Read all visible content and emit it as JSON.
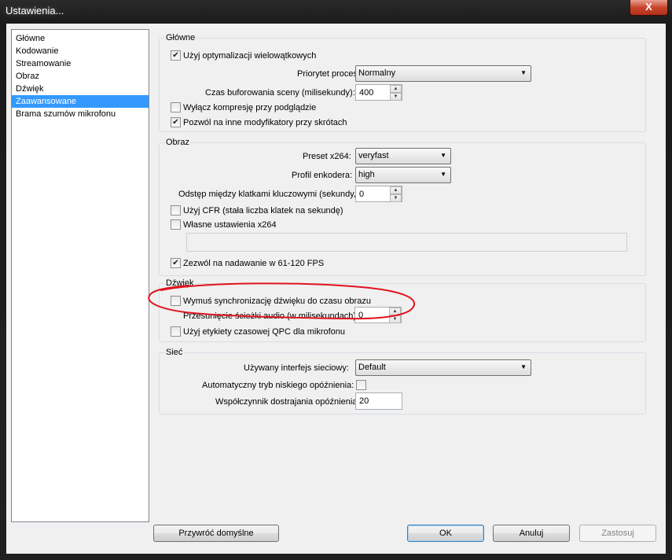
{
  "window": {
    "title": "Ustawienia...",
    "close_label": "X",
    "close_icon": "close-icon"
  },
  "sidebar": {
    "items": [
      {
        "label": "Główne"
      },
      {
        "label": "Kodowanie"
      },
      {
        "label": "Streamowanie"
      },
      {
        "label": "Obraz"
      },
      {
        "label": "Dźwięk"
      },
      {
        "label": "Zaawansowane",
        "selected": true
      },
      {
        "label": "Brama szumów mikrofonu"
      }
    ]
  },
  "general": {
    "title": "Główne",
    "multithread_label": "Użyj optymalizacji wielowątkowych",
    "multithread_checked": true,
    "priority_label": "Priorytet procesu",
    "priority_value": "Normalny",
    "buffer_label": "Czas buforowania sceny (milisekundy):",
    "buffer_value": "400",
    "disable_preview_compress_label": "Wyłącz kompresję przy podglądzie",
    "disable_preview_compress_checked": false,
    "hotkey_modifiers_label": "Pozwól na inne modyfikatory przy skrótach",
    "hotkey_modifiers_checked": true
  },
  "video": {
    "title": "Obraz",
    "preset_label": "Preset x264:",
    "preset_value": "veryfast",
    "profile_label": "Profil enkodera:",
    "profile_value": "high",
    "keyframe_label": "Odstęp między klatkami kluczowymi (sekundy,",
    "keyframe_value": "0",
    "cfr_label": "Użyj CFR (stała liczba klatek na sekundę)",
    "cfr_checked": false,
    "custom_x264_label": "Własne ustawienia x264",
    "custom_x264_checked": false,
    "custom_x264_value": "",
    "fps_61_120_label": "Zezwól na nadawanie w 61-120 FPS",
    "fps_61_120_checked": true
  },
  "audio": {
    "title": "Dźwięk",
    "force_sync_label": "Wymuś synchronizację dźwięku do czasu obrazu",
    "force_sync_checked": false,
    "offset_label": "Przesunięcie ścieżki audio (w milisekundach):",
    "offset_value": "0",
    "qpc_label": "Użyj etykiety czasowej QPC dla mikrofonu",
    "qpc_checked": false
  },
  "network": {
    "title": "Sieć",
    "interface_label": "Używany interfejs sieciowy:",
    "interface_value": "Default",
    "low_latency_label": "Automatyczny tryb niskiego opóźnienia:",
    "low_latency_checked": false,
    "latency_factor_label": "Współczynnik dostrajania opóźnienia",
    "latency_factor_value": "20"
  },
  "buttons": {
    "restore_defaults": "Przywróć domyślne",
    "ok": "OK",
    "cancel": "Anuluj",
    "apply": "Zastosuj"
  },
  "colors": {
    "selection": "#3399ff",
    "annotation": "#e0141e"
  }
}
